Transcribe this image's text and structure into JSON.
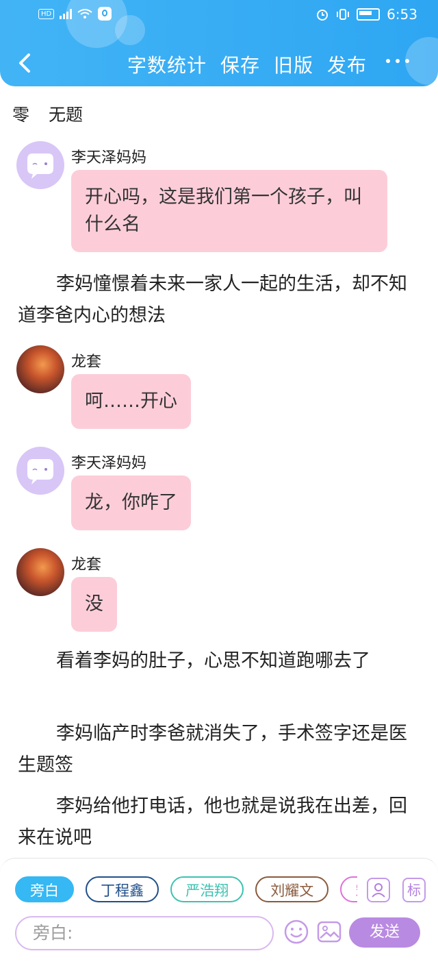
{
  "status_bar": {
    "network": "HD",
    "time": "6:53"
  },
  "toolbar": {
    "items": [
      "字数统计",
      "保存",
      "旧版",
      "发布"
    ]
  },
  "chapter": {
    "number": "零",
    "title": "无题"
  },
  "messages": [
    {
      "sender": "李天泽妈妈",
      "text": "开心吗，这是我们第一个孩子，叫什么名"
    },
    {
      "sender": "龙套",
      "text": "呵……开心"
    },
    {
      "sender": "李天泽妈妈",
      "text": "龙，你咋了"
    },
    {
      "sender": "龙套",
      "text": "没"
    }
  ],
  "narrations": [
    "李妈憧憬着未来一家人一起的生活，却不知道李爸内心的想法",
    "看着李妈的肚子，心思不知道跑哪去了",
    "李妈临产时李爸就消失了，手术签字还是医生题签",
    "李妈给他打电话，他也就是说我在出差，回来在说吧"
  ],
  "input_panel": {
    "characters": [
      {
        "label": "旁白",
        "color": "#35b8f3"
      },
      {
        "label": "丁程鑫",
        "color": "#1f4f8a"
      },
      {
        "label": "严浩翔",
        "color": "#3cc2b0"
      },
      {
        "label": "刘耀文",
        "color": "#8a5a3c"
      },
      {
        "label": "宋亚轩",
        "color": "#e070d9"
      }
    ],
    "tag_label": "标",
    "placeholder": "旁白:",
    "send_label": "发送"
  },
  "colors": {
    "header": "#2ea6f2",
    "bubble": "#fccdd9",
    "accent_purple": "#b98ae2"
  }
}
